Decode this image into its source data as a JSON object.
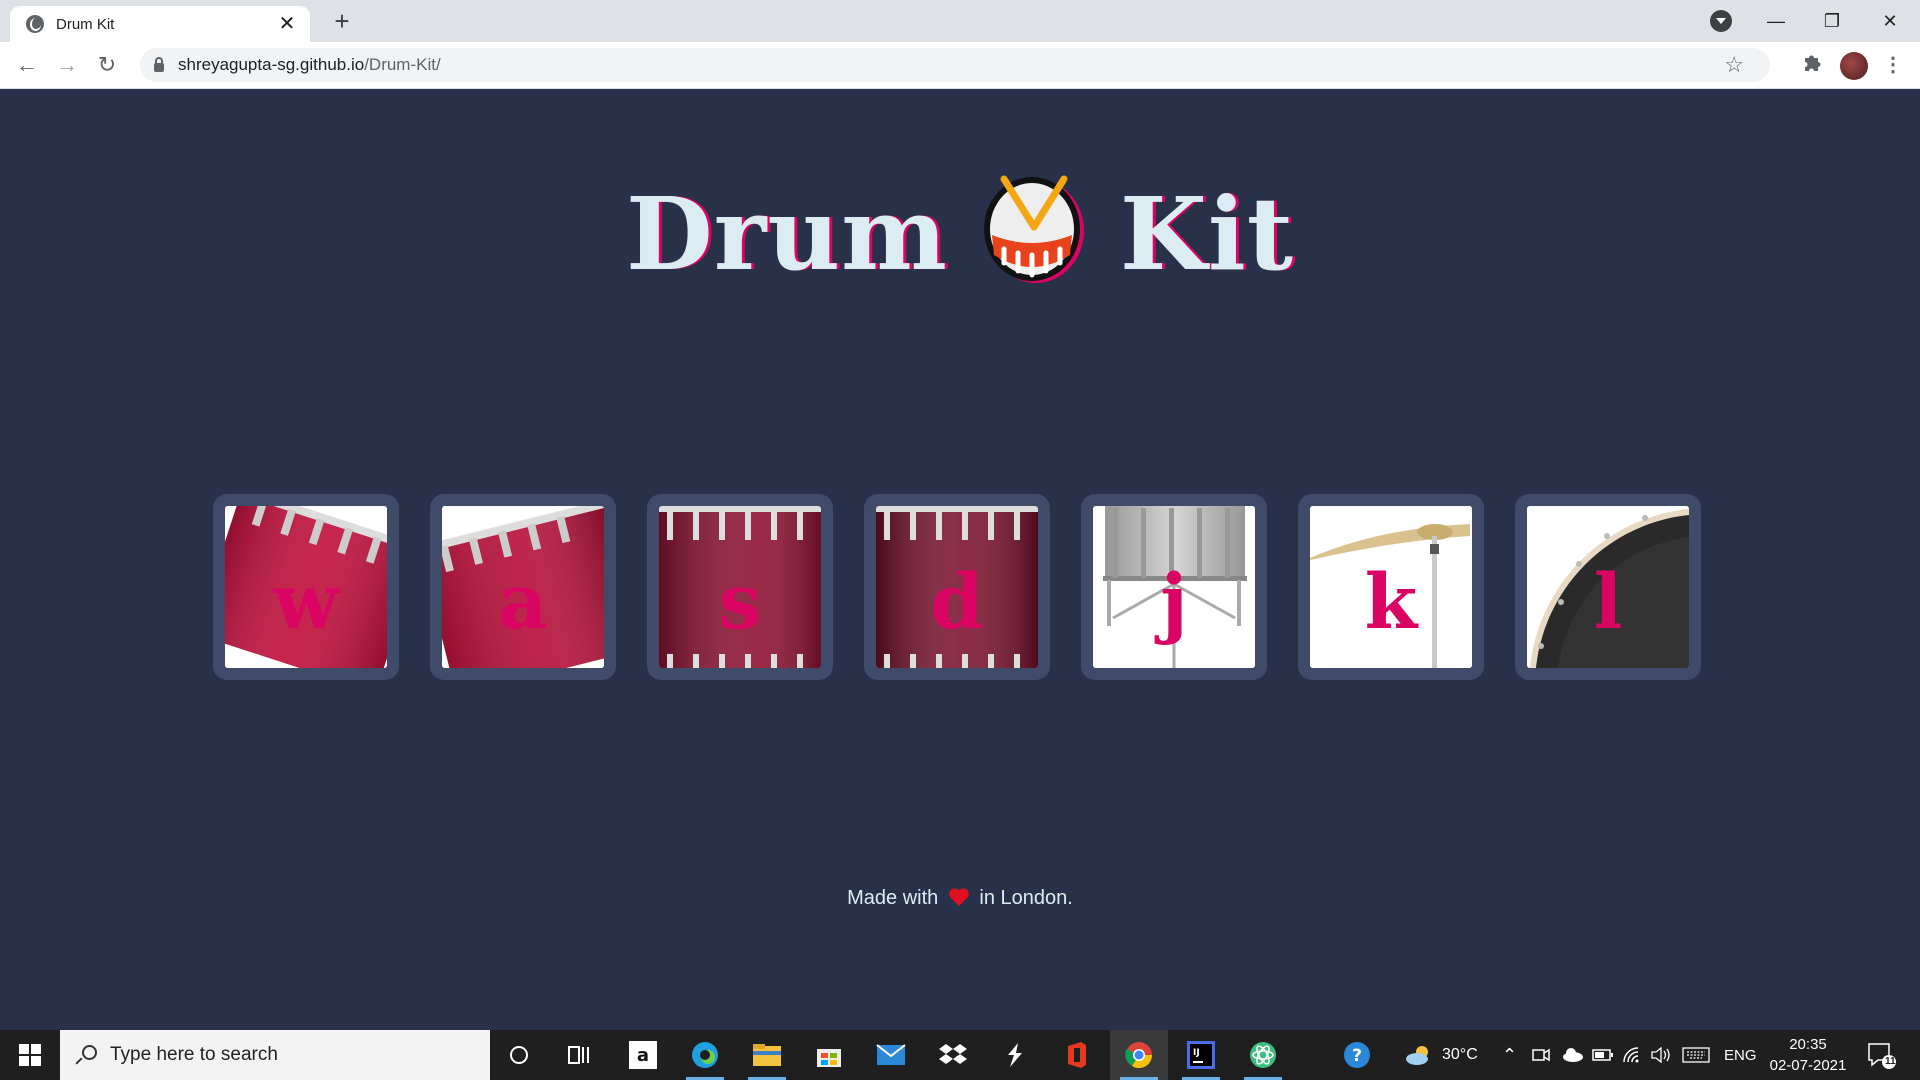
{
  "browser": {
    "tab_title": "Drum Kit",
    "url_host": "shreyagupta-sg.github.io",
    "url_path": "/Drum-Kit/"
  },
  "page": {
    "heading_left": "Drum",
    "heading_right": "Kit",
    "drums": [
      {
        "key": "w",
        "kind": "tom"
      },
      {
        "key": "a",
        "kind": "tom"
      },
      {
        "key": "s",
        "kind": "tom"
      },
      {
        "key": "d",
        "kind": "tom"
      },
      {
        "key": "j",
        "kind": "snare"
      },
      {
        "key": "k",
        "kind": "crash"
      },
      {
        "key": "l",
        "kind": "kick"
      }
    ],
    "footer_before": "Made with",
    "footer_after": "in London."
  },
  "taskbar": {
    "search_placeholder": "Type here to search",
    "weather": "30°C",
    "language": "ENG",
    "time": "20:35",
    "date": "02-07-2021",
    "notification_count": "11"
  },
  "colors": {
    "background": "#283149",
    "tile": "#404b69",
    "accent": "#da0463",
    "text": "#dbedf3"
  }
}
